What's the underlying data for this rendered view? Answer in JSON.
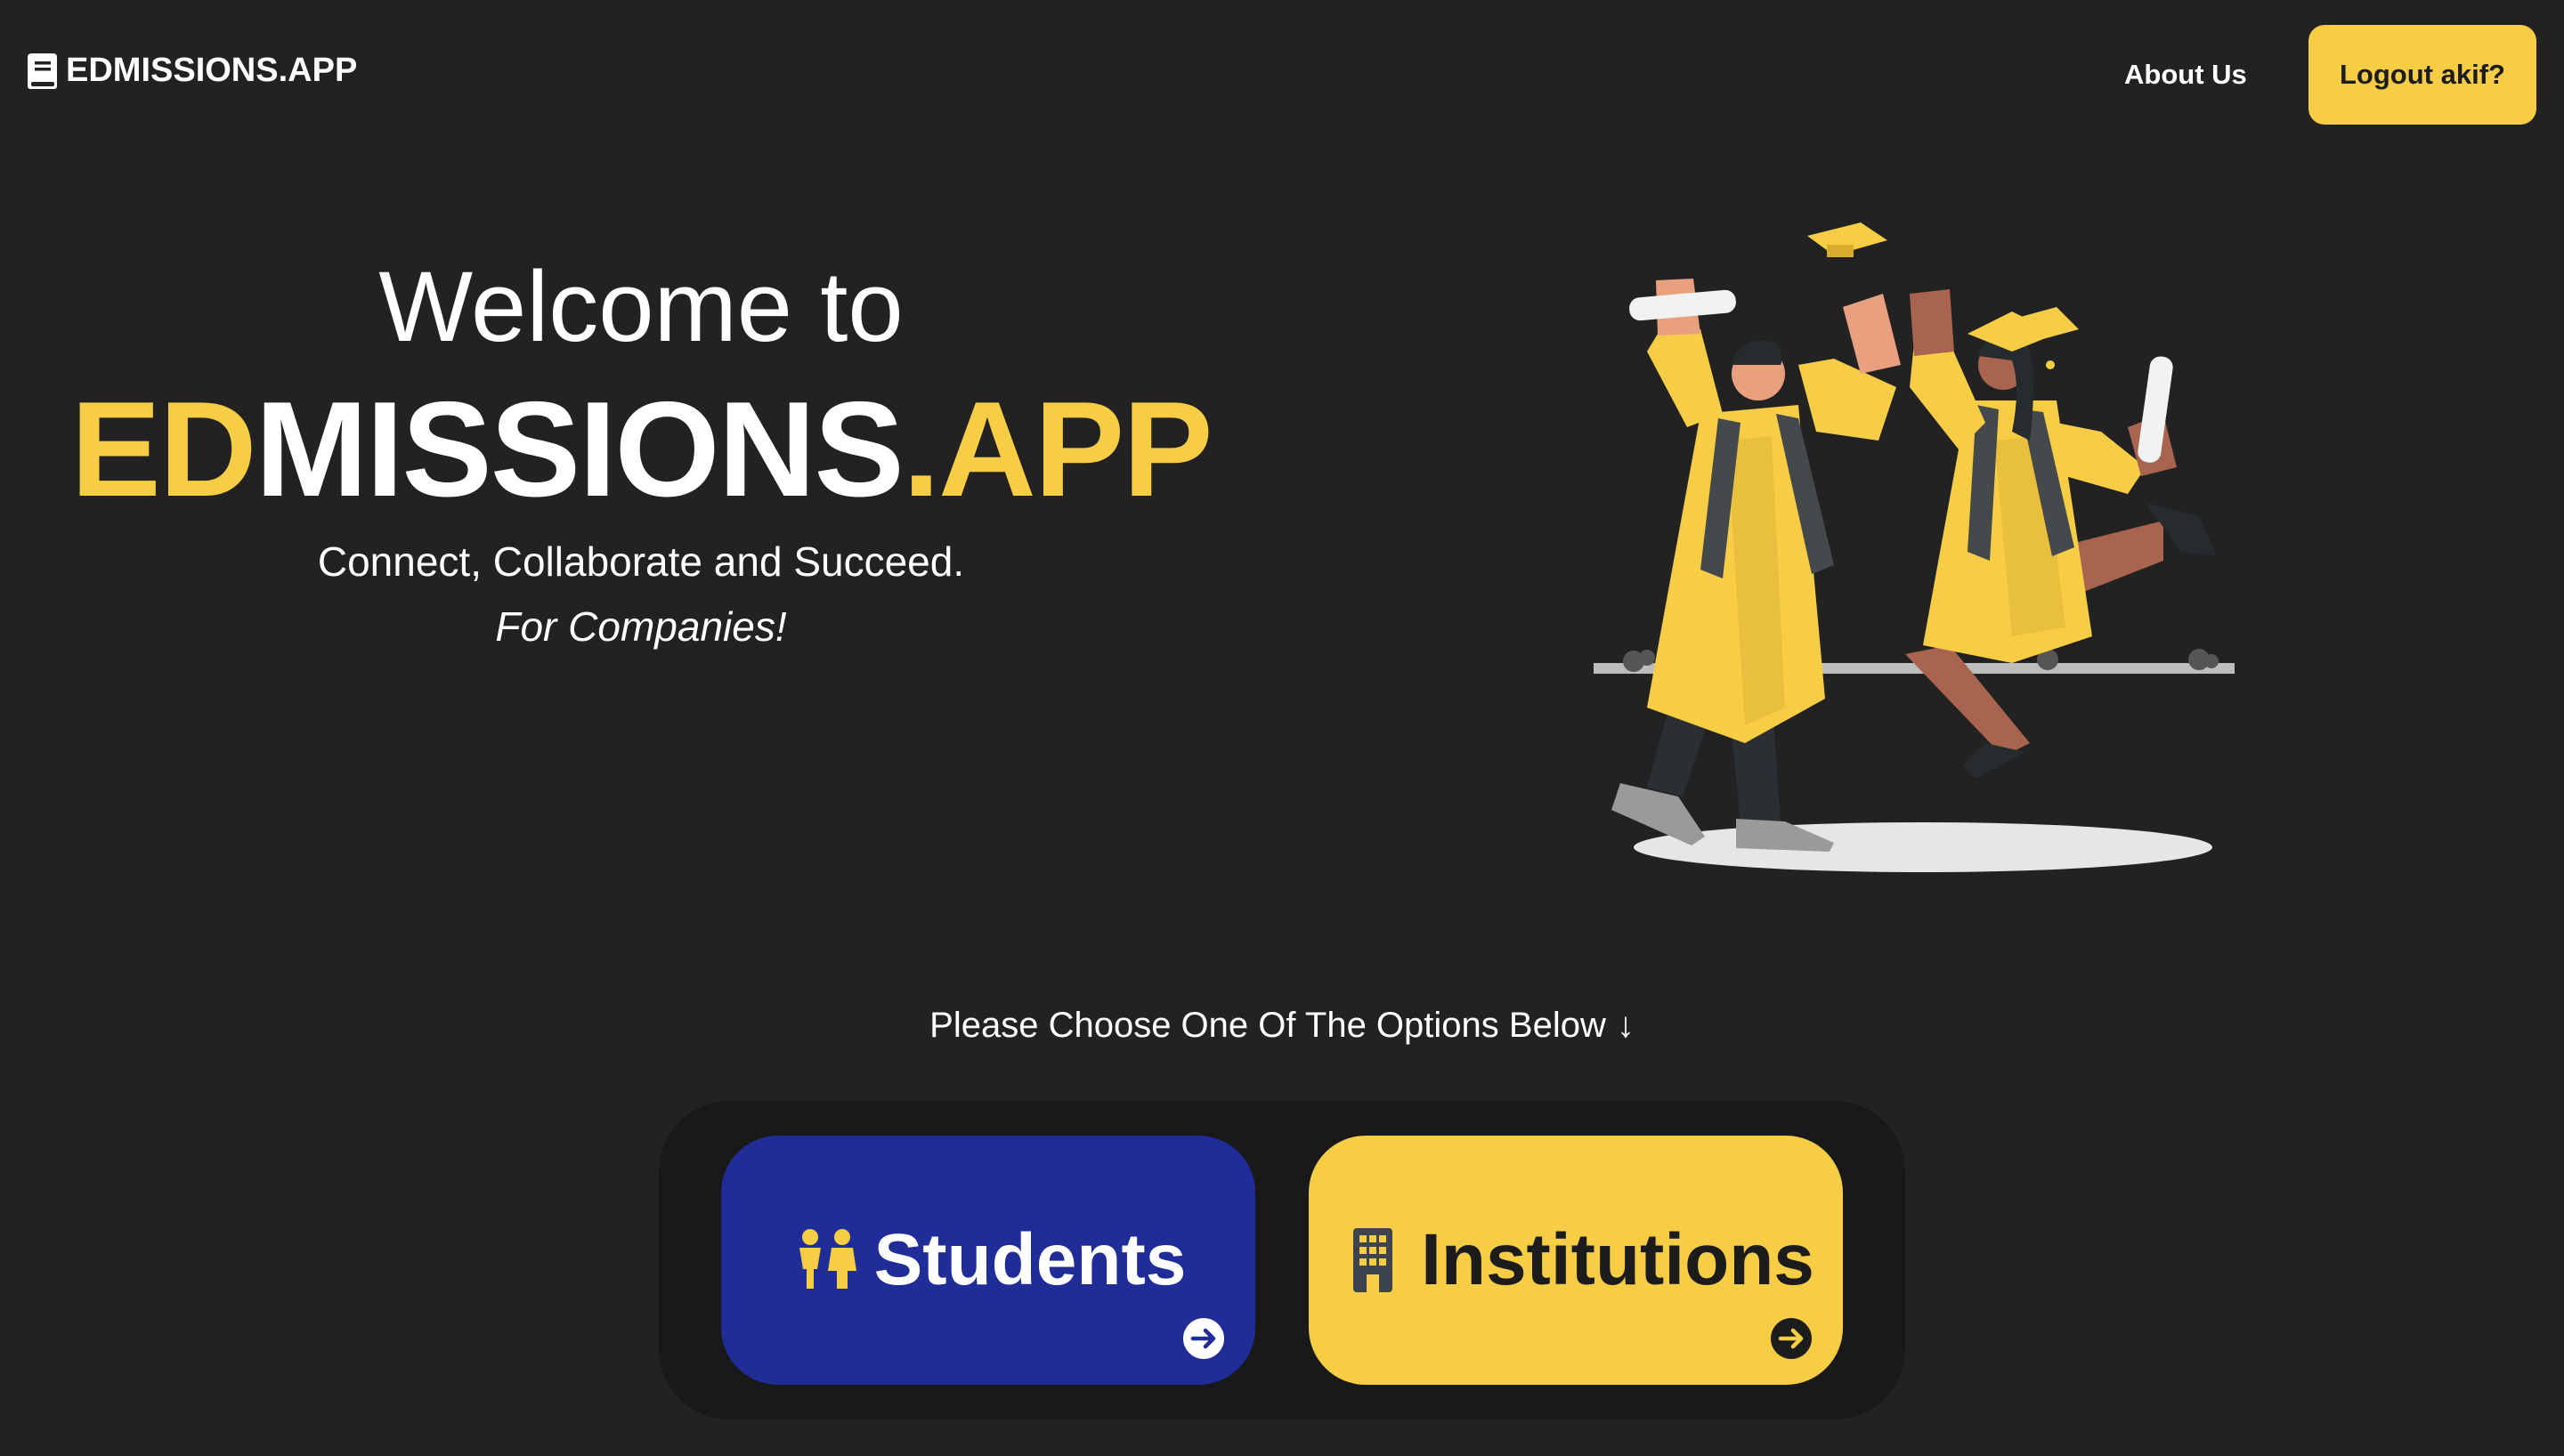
{
  "nav": {
    "brand": "EDMISSIONS.APP",
    "about_label": "About Us",
    "logout_label": "Logout akif?"
  },
  "hero": {
    "welcome": "Welcome to",
    "brand_ed": "ED",
    "brand_missions": "MISSIONS",
    "brand_app": ".APP",
    "tagline": "Connect, Collaborate and Succeed.",
    "audience": "For Companies!"
  },
  "choose": {
    "prompt": "Please Choose One Of The Options Below",
    "arrow": "↓"
  },
  "options": {
    "students_label": "Students",
    "institutions_label": "Institutions"
  },
  "colors": {
    "background": "#222222",
    "accent": "#f7cd45",
    "students_card": "#202c98",
    "panel": "#191919"
  },
  "icons": {
    "brand": "book-icon",
    "students": "children-icon",
    "institutions": "building-icon",
    "go": "arrow-right-circle-icon"
  }
}
